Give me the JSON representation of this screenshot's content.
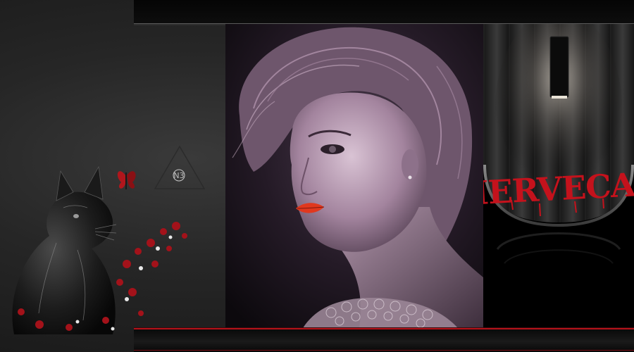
{
  "banner": {
    "signature": "MERVECAN",
    "logo_text": "N3"
  },
  "icons": {
    "lamp": "wall-lamp-icon",
    "butterfly": "butterfly-icon",
    "logo": "triangle-logo-icon"
  },
  "colors": {
    "background": "#262626",
    "accent_red": "#c4121c",
    "bar_dark": "#050505",
    "portrait_tint": "#8a6a86"
  }
}
